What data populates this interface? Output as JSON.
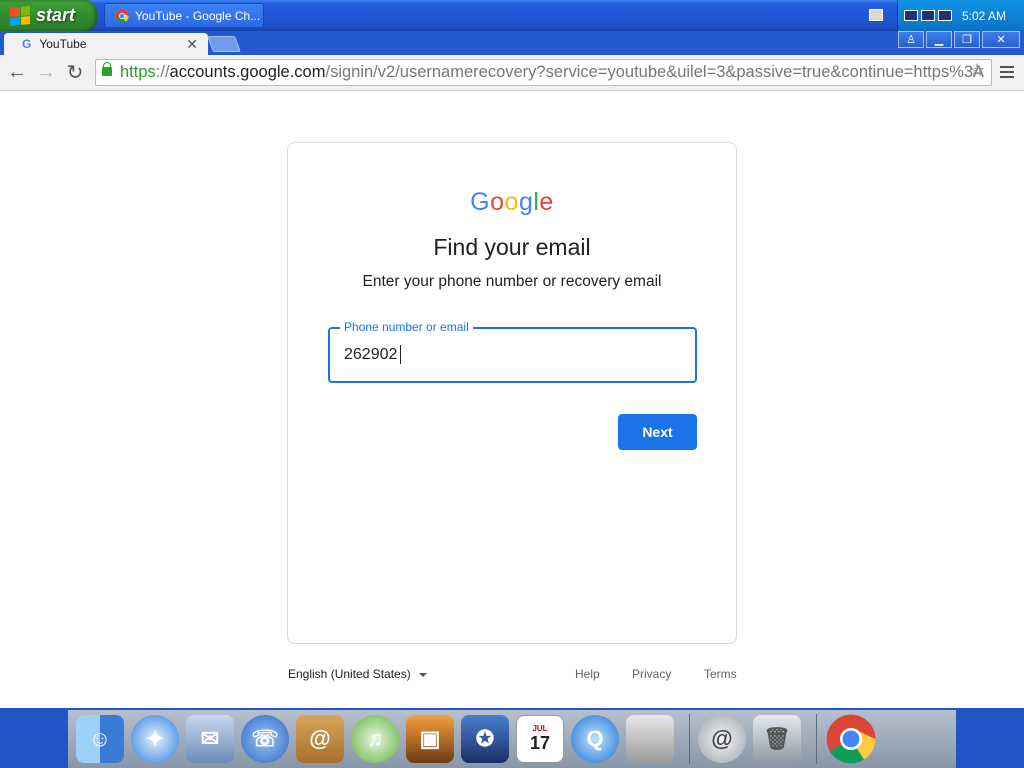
{
  "taskbar": {
    "start_label": "start",
    "task_button_label": "YouTube - Google Ch...",
    "clock": "5:02 AM"
  },
  "browser": {
    "tab_title": "YouTube",
    "url_scheme": "https",
    "url_sep": "://",
    "url_host": "accounts.google.com",
    "url_path": "/signin/v2/usernamerecovery?service=youtube&uilel=3&passive=true&continue=https%3A"
  },
  "page": {
    "logo": [
      "G",
      "o",
      "o",
      "g",
      "l",
      "e"
    ],
    "logo_colors": [
      "#4285f4",
      "#ea4335",
      "#fbbc05",
      "#4285f4",
      "#34a853",
      "#ea4335"
    ],
    "title": "Find your email",
    "subtitle": "Enter your phone number or recovery email",
    "field_label": "Phone number or email",
    "field_value": "262902",
    "next_label": "Next"
  },
  "footer": {
    "language": "English (United States)",
    "help": "Help",
    "privacy": "Privacy",
    "terms": "Terms"
  },
  "dock": {
    "items": [
      "finder-icon",
      "safari-icon",
      "mail-icon",
      "ichat-icon",
      "address-book-icon",
      "itunes-icon",
      "iphoto-icon",
      "imovie-icon",
      "ical-icon",
      "quicktime-icon",
      "system-preferences-icon",
      "mail-at-icon",
      "trash-icon",
      "chrome-icon"
    ],
    "ical_month": "JUL",
    "ical_day": "17"
  },
  "colors": {
    "accent": "#1a73e8",
    "xp_blue": "#245edb",
    "start_green": "#3a9b36"
  }
}
